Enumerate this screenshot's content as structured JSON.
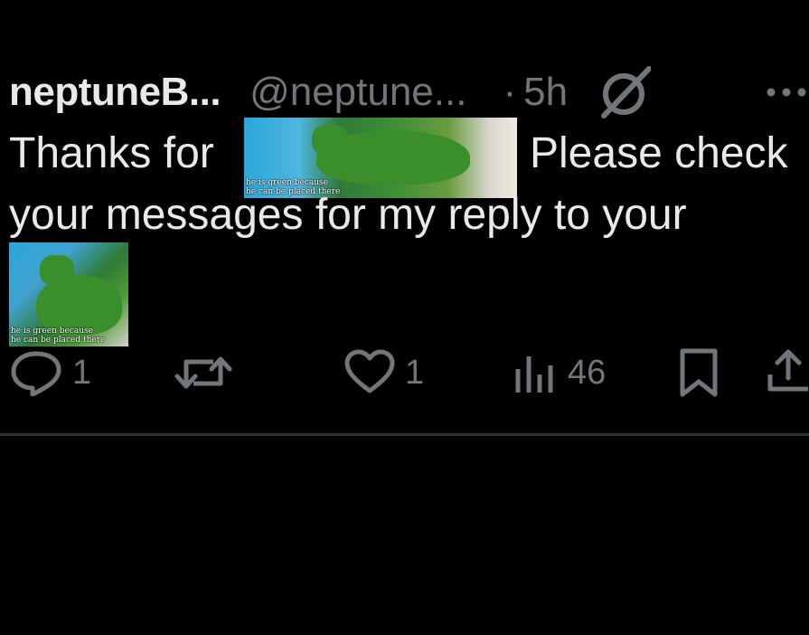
{
  "post": {
    "display_name": "neptuneB...",
    "handle": "@neptune...",
    "separator": "·",
    "time": "5h",
    "text_line1_before": "Thanks for",
    "text_line1_after": "Please check",
    "text_line2": "your messages for my reply to your",
    "image_caption": "he is green because\nhe can be placed there"
  },
  "actions": {
    "reply_count": "1",
    "like_count": "1",
    "views_count": "46"
  },
  "colors": {
    "background": "#000000",
    "text": "#e7e9ea",
    "muted": "#71767b",
    "divider": "#2f3336"
  }
}
